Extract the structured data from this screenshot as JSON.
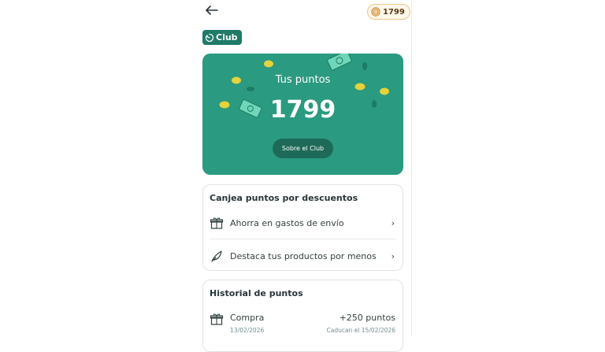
{
  "header": {
    "back_icon": "arrow-left-icon",
    "points_badge": "1799",
    "coin_icon": "coin-icon"
  },
  "brand": {
    "logo_text": "Club",
    "logo_icon": "club-leaf-icon",
    "color": "#1f7a68"
  },
  "hero": {
    "title": "Tus puntos",
    "points": "1799",
    "about_button": "Sobre el Club",
    "background": "#2a9a80"
  },
  "redeem": {
    "title": "Canjea puntos por descuentos",
    "items": [
      {
        "label": "Ahorra en gastos de envío",
        "icon": "gift-box-icon"
      },
      {
        "label": "Destaca tus productos por menos",
        "icon": "feather-icon"
      }
    ]
  },
  "history": {
    "title": "Historial de puntos",
    "entries": [
      {
        "name": "Compra",
        "date": "13/02/2026",
        "points": "+250 puntos",
        "expiry": "Caducan el 15/02/2026",
        "icon": "gift-box-icon"
      }
    ]
  }
}
